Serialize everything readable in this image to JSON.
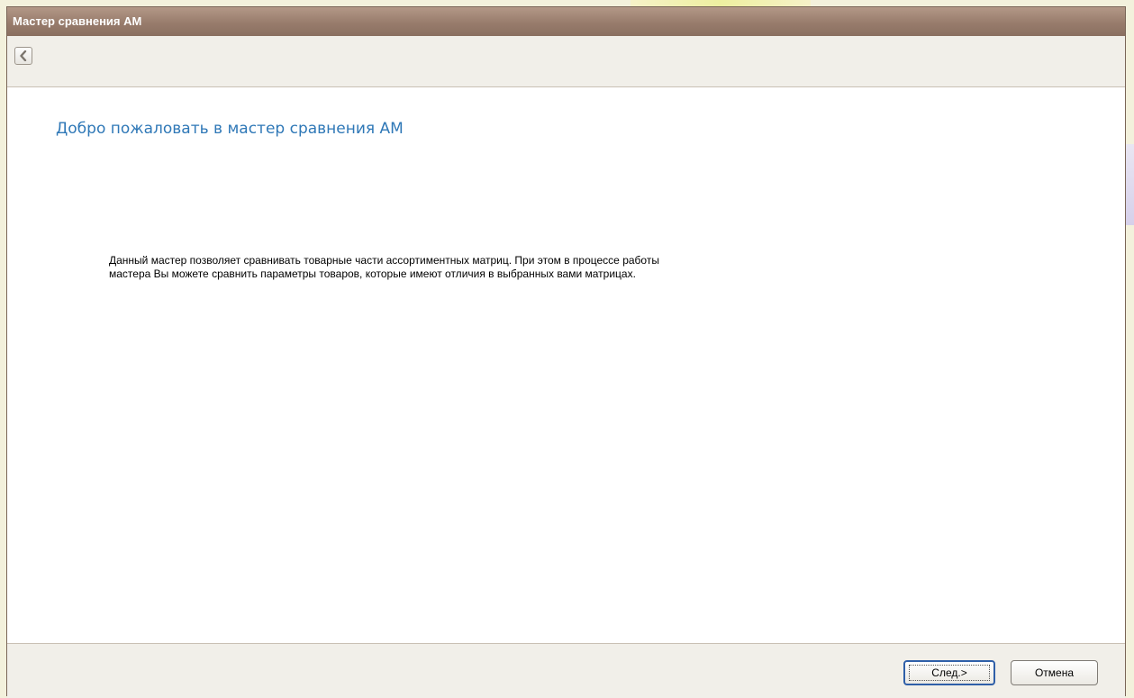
{
  "window": {
    "title": "Мастер сравнения АМ"
  },
  "toolbar": {
    "back_icon": "chevron-left-icon"
  },
  "content": {
    "heading": "Добро пожаловать в мастер сравнения АМ",
    "description_line1": "Данный мастер позволяет сравнивать товарные части ассортиментных матриц. При этом в процессе работы",
    "description_line2": "мастера Вы можете сравнить параметры товаров, которые имеют отличия в выбранных вами матрицах."
  },
  "footer": {
    "next_label": "След.>",
    "cancel_label": "Отмена"
  },
  "colors": {
    "titlebar": "#987c6c",
    "heading": "#2f78b7",
    "panel": "#f1efe9"
  }
}
